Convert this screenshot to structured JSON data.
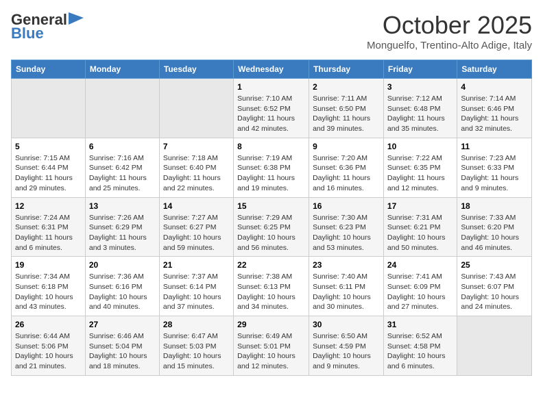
{
  "header": {
    "logo_line1": "General",
    "logo_line2": "Blue",
    "month": "October 2025",
    "location": "Monguelfo, Trentino-Alto Adige, Italy"
  },
  "weekdays": [
    "Sunday",
    "Monday",
    "Tuesday",
    "Wednesday",
    "Thursday",
    "Friday",
    "Saturday"
  ],
  "weeks": [
    [
      {
        "day": "",
        "info": ""
      },
      {
        "day": "",
        "info": ""
      },
      {
        "day": "",
        "info": ""
      },
      {
        "day": "1",
        "info": "Sunrise: 7:10 AM\nSunset: 6:52 PM\nDaylight: 11 hours and 42 minutes."
      },
      {
        "day": "2",
        "info": "Sunrise: 7:11 AM\nSunset: 6:50 PM\nDaylight: 11 hours and 39 minutes."
      },
      {
        "day": "3",
        "info": "Sunrise: 7:12 AM\nSunset: 6:48 PM\nDaylight: 11 hours and 35 minutes."
      },
      {
        "day": "4",
        "info": "Sunrise: 7:14 AM\nSunset: 6:46 PM\nDaylight: 11 hours and 32 minutes."
      }
    ],
    [
      {
        "day": "5",
        "info": "Sunrise: 7:15 AM\nSunset: 6:44 PM\nDaylight: 11 hours and 29 minutes."
      },
      {
        "day": "6",
        "info": "Sunrise: 7:16 AM\nSunset: 6:42 PM\nDaylight: 11 hours and 25 minutes."
      },
      {
        "day": "7",
        "info": "Sunrise: 7:18 AM\nSunset: 6:40 PM\nDaylight: 11 hours and 22 minutes."
      },
      {
        "day": "8",
        "info": "Sunrise: 7:19 AM\nSunset: 6:38 PM\nDaylight: 11 hours and 19 minutes."
      },
      {
        "day": "9",
        "info": "Sunrise: 7:20 AM\nSunset: 6:36 PM\nDaylight: 11 hours and 16 minutes."
      },
      {
        "day": "10",
        "info": "Sunrise: 7:22 AM\nSunset: 6:35 PM\nDaylight: 11 hours and 12 minutes."
      },
      {
        "day": "11",
        "info": "Sunrise: 7:23 AM\nSunset: 6:33 PM\nDaylight: 11 hours and 9 minutes."
      }
    ],
    [
      {
        "day": "12",
        "info": "Sunrise: 7:24 AM\nSunset: 6:31 PM\nDaylight: 11 hours and 6 minutes."
      },
      {
        "day": "13",
        "info": "Sunrise: 7:26 AM\nSunset: 6:29 PM\nDaylight: 11 hours and 3 minutes."
      },
      {
        "day": "14",
        "info": "Sunrise: 7:27 AM\nSunset: 6:27 PM\nDaylight: 10 hours and 59 minutes."
      },
      {
        "day": "15",
        "info": "Sunrise: 7:29 AM\nSunset: 6:25 PM\nDaylight: 10 hours and 56 minutes."
      },
      {
        "day": "16",
        "info": "Sunrise: 7:30 AM\nSunset: 6:23 PM\nDaylight: 10 hours and 53 minutes."
      },
      {
        "day": "17",
        "info": "Sunrise: 7:31 AM\nSunset: 6:21 PM\nDaylight: 10 hours and 50 minutes."
      },
      {
        "day": "18",
        "info": "Sunrise: 7:33 AM\nSunset: 6:20 PM\nDaylight: 10 hours and 46 minutes."
      }
    ],
    [
      {
        "day": "19",
        "info": "Sunrise: 7:34 AM\nSunset: 6:18 PM\nDaylight: 10 hours and 43 minutes."
      },
      {
        "day": "20",
        "info": "Sunrise: 7:36 AM\nSunset: 6:16 PM\nDaylight: 10 hours and 40 minutes."
      },
      {
        "day": "21",
        "info": "Sunrise: 7:37 AM\nSunset: 6:14 PM\nDaylight: 10 hours and 37 minutes."
      },
      {
        "day": "22",
        "info": "Sunrise: 7:38 AM\nSunset: 6:13 PM\nDaylight: 10 hours and 34 minutes."
      },
      {
        "day": "23",
        "info": "Sunrise: 7:40 AM\nSunset: 6:11 PM\nDaylight: 10 hours and 30 minutes."
      },
      {
        "day": "24",
        "info": "Sunrise: 7:41 AM\nSunset: 6:09 PM\nDaylight: 10 hours and 27 minutes."
      },
      {
        "day": "25",
        "info": "Sunrise: 7:43 AM\nSunset: 6:07 PM\nDaylight: 10 hours and 24 minutes."
      }
    ],
    [
      {
        "day": "26",
        "info": "Sunrise: 6:44 AM\nSunset: 5:06 PM\nDaylight: 10 hours and 21 minutes."
      },
      {
        "day": "27",
        "info": "Sunrise: 6:46 AM\nSunset: 5:04 PM\nDaylight: 10 hours and 18 minutes."
      },
      {
        "day": "28",
        "info": "Sunrise: 6:47 AM\nSunset: 5:03 PM\nDaylight: 10 hours and 15 minutes."
      },
      {
        "day": "29",
        "info": "Sunrise: 6:49 AM\nSunset: 5:01 PM\nDaylight: 10 hours and 12 minutes."
      },
      {
        "day": "30",
        "info": "Sunrise: 6:50 AM\nSunset: 4:59 PM\nDaylight: 10 hours and 9 minutes."
      },
      {
        "day": "31",
        "info": "Sunrise: 6:52 AM\nSunset: 4:58 PM\nDaylight: 10 hours and 6 minutes."
      },
      {
        "day": "",
        "info": ""
      }
    ]
  ]
}
